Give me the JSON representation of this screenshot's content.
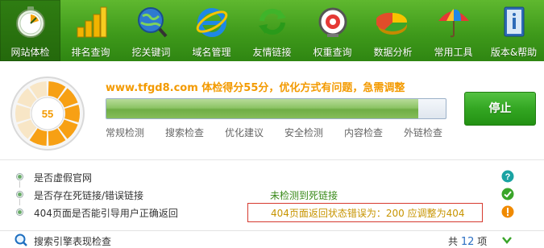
{
  "toolbar": {
    "items": [
      {
        "label": "网站体检",
        "icon": "stopwatch-icon",
        "active": true
      },
      {
        "label": "排名查询",
        "icon": "bar-chart-icon",
        "active": false
      },
      {
        "label": "挖关键词",
        "icon": "globe-search-icon",
        "active": false
      },
      {
        "label": "域名管理",
        "icon": "ie-browser-icon",
        "active": false
      },
      {
        "label": "友情链接",
        "icon": "refresh-arrows-icon",
        "active": false
      },
      {
        "label": "权重查询",
        "icon": "monitor-gauge-icon",
        "active": false
      },
      {
        "label": "数据分析",
        "icon": "pie-chart-icon",
        "active": false
      },
      {
        "label": "常用工具",
        "icon": "umbrella-icon",
        "active": false
      },
      {
        "label": "版本&帮助",
        "icon": "info-book-icon",
        "active": false
      }
    ]
  },
  "score": {
    "value": "55",
    "headline": "www.tfgd8.com 体检得分55分，优化方式有问题，急需调整",
    "progress": 0.92,
    "stop_label": "停止"
  },
  "subtabs": [
    "常规检测",
    "搜索检查",
    "优化建议",
    "安全检测",
    "内容检查",
    "外链检查"
  ],
  "results": [
    {
      "label": "是否虚假官网",
      "result": "",
      "status": "help",
      "status_icon": "question-icon"
    },
    {
      "label": "是否存在死链接/错误链接",
      "result": "未检测到死链接",
      "status": "ok",
      "status_icon": "check-icon"
    },
    {
      "label": "404页面是否能引导用户正确返回",
      "result": "404页面返回状态错误为：200 应调整为404",
      "status": "warn",
      "status_icon": "warning-icon"
    }
  ],
  "section": {
    "title": "搜索引擎表现检查",
    "count_prefix": "共",
    "count": "12",
    "count_suffix": "项"
  },
  "colors": {
    "toolbar": "#3f9a1b",
    "headline": "#f39a00",
    "ok": "#3a8a1a",
    "warn": "#e8a317",
    "error_box": "#d63a2f",
    "count": "#2c6fc3"
  }
}
